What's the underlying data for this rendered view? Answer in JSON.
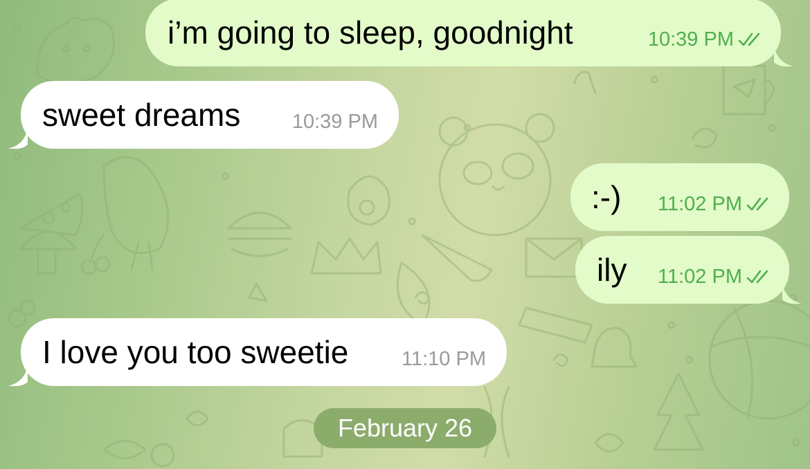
{
  "theme": {
    "outgoing_bubble": "#e2fbc9",
    "incoming_bubble": "#ffffff",
    "outgoing_time_color": "#4fae4e",
    "incoming_time_color": "#9a9a9a",
    "date_pill_color": "#8cac6c"
  },
  "messages": [
    {
      "direction": "outgoing",
      "text": "i’m going to sleep, goodnight",
      "time": "10:39 PM",
      "status": "read"
    },
    {
      "direction": "incoming",
      "text": "sweet dreams",
      "time": "10:39 PM"
    },
    {
      "direction": "outgoing",
      "text": ":-)",
      "time": "11:02 PM",
      "status": "read"
    },
    {
      "direction": "outgoing",
      "text": "ily",
      "time": "11:02 PM",
      "status": "read"
    },
    {
      "direction": "incoming",
      "text": "I love you too sweetie",
      "time": "11:10 PM"
    }
  ],
  "date_separator": "February 26",
  "icons": {
    "read_receipt": "double-check-icon"
  }
}
